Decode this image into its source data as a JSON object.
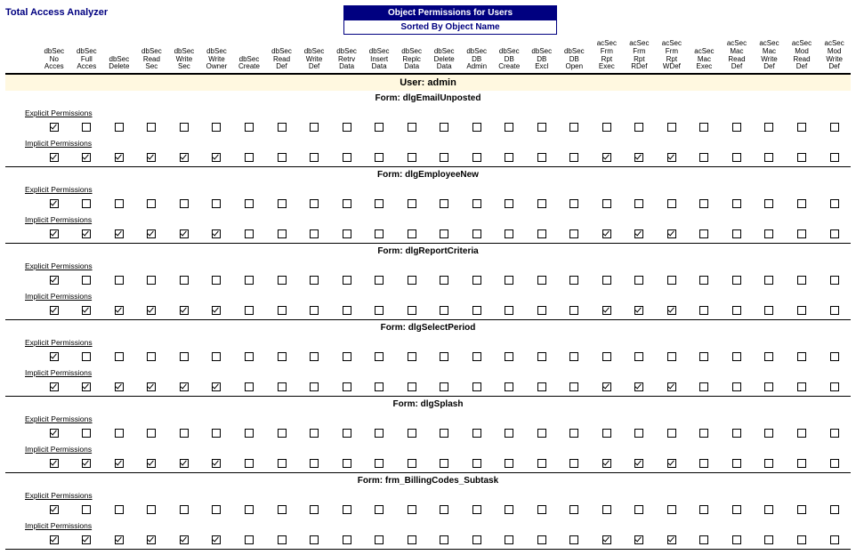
{
  "app_title": "Total Access Analyzer",
  "header_title": "Object Permissions for Users",
  "header_subtitle": "Sorted By Object Name",
  "user_prefix": "User:",
  "user_name": "admin",
  "form_prefix": "Form:",
  "explicit_label": "Explicit Permissions",
  "implicit_label": "Implicit Permissions",
  "columns": [
    "dbSec\nNo\nAcces",
    "dbSec\nFull\nAcces",
    "dbSec\nDelete",
    "dbSec\nRead\nSec",
    "dbSec\nWrite\nSec",
    "dbSec\nWrite\nOwner",
    "dbSec\nCreate",
    "dbSec\nRead\nDef",
    "dbSec\nWrite\nDef",
    "dbSec\nRetrv\nData",
    "dbSec\nInsert\nData",
    "dbSec\nReplc\nData",
    "dbSec\nDelete\nData",
    "dbSec\nDB\nAdmin",
    "dbSec\nDB\nCreate",
    "dbSec\nDB\nExcl",
    "dbSec\nDB\nOpen",
    "acSec\nFrm\nRpt\nExec",
    "acSec\nFrm\nRpt\nRDef",
    "acSec\nFrm\nRpt\nWDef",
    "acSec\nMac\nExec",
    "acSec\nMac\nRead\nDef",
    "acSec\nMac\nWrite\nDef",
    "acSec\nMod\nRead\nDef",
    "acSec\nMod\nWrite\nDef"
  ],
  "forms": [
    {
      "name": "dlgEmailUnposted",
      "explicit": [
        true,
        false,
        false,
        false,
        false,
        false,
        false,
        false,
        false,
        false,
        false,
        false,
        false,
        false,
        false,
        false,
        false,
        false,
        false,
        false,
        false,
        false,
        false,
        false,
        false
      ],
      "implicit": [
        true,
        true,
        true,
        true,
        true,
        true,
        false,
        false,
        false,
        false,
        false,
        false,
        false,
        false,
        false,
        false,
        false,
        true,
        true,
        true,
        false,
        false,
        false,
        false,
        false
      ]
    },
    {
      "name": "dlgEmployeeNew",
      "explicit": [
        true,
        false,
        false,
        false,
        false,
        false,
        false,
        false,
        false,
        false,
        false,
        false,
        false,
        false,
        false,
        false,
        false,
        false,
        false,
        false,
        false,
        false,
        false,
        false,
        false
      ],
      "implicit": [
        true,
        true,
        true,
        true,
        true,
        true,
        false,
        false,
        false,
        false,
        false,
        false,
        false,
        false,
        false,
        false,
        false,
        true,
        true,
        true,
        false,
        false,
        false,
        false,
        false
      ]
    },
    {
      "name": "dlgReportCriteria",
      "explicit": [
        true,
        false,
        false,
        false,
        false,
        false,
        false,
        false,
        false,
        false,
        false,
        false,
        false,
        false,
        false,
        false,
        false,
        false,
        false,
        false,
        false,
        false,
        false,
        false,
        false
      ],
      "implicit": [
        true,
        true,
        true,
        true,
        true,
        true,
        false,
        false,
        false,
        false,
        false,
        false,
        false,
        false,
        false,
        false,
        false,
        true,
        true,
        true,
        false,
        false,
        false,
        false,
        false
      ]
    },
    {
      "name": "dlgSelectPeriod",
      "explicit": [
        true,
        false,
        false,
        false,
        false,
        false,
        false,
        false,
        false,
        false,
        false,
        false,
        false,
        false,
        false,
        false,
        false,
        false,
        false,
        false,
        false,
        false,
        false,
        false,
        false
      ],
      "implicit": [
        true,
        true,
        true,
        true,
        true,
        true,
        false,
        false,
        false,
        false,
        false,
        false,
        false,
        false,
        false,
        false,
        false,
        true,
        true,
        true,
        false,
        false,
        false,
        false,
        false
      ]
    },
    {
      "name": "dlgSplash",
      "explicit": [
        true,
        false,
        false,
        false,
        false,
        false,
        false,
        false,
        false,
        false,
        false,
        false,
        false,
        false,
        false,
        false,
        false,
        false,
        false,
        false,
        false,
        false,
        false,
        false,
        false
      ],
      "implicit": [
        true,
        true,
        true,
        true,
        true,
        true,
        false,
        false,
        false,
        false,
        false,
        false,
        false,
        false,
        false,
        false,
        false,
        true,
        true,
        true,
        false,
        false,
        false,
        false,
        false
      ]
    },
    {
      "name": "frm_BillingCodes_Subtask",
      "explicit": [
        true,
        false,
        false,
        false,
        false,
        false,
        false,
        false,
        false,
        false,
        false,
        false,
        false,
        false,
        false,
        false,
        false,
        false,
        false,
        false,
        false,
        false,
        false,
        false,
        false
      ],
      "implicit": [
        true,
        true,
        true,
        true,
        true,
        true,
        false,
        false,
        false,
        false,
        false,
        false,
        false,
        false,
        false,
        false,
        false,
        true,
        true,
        true,
        false,
        false,
        false,
        false,
        false
      ]
    }
  ]
}
